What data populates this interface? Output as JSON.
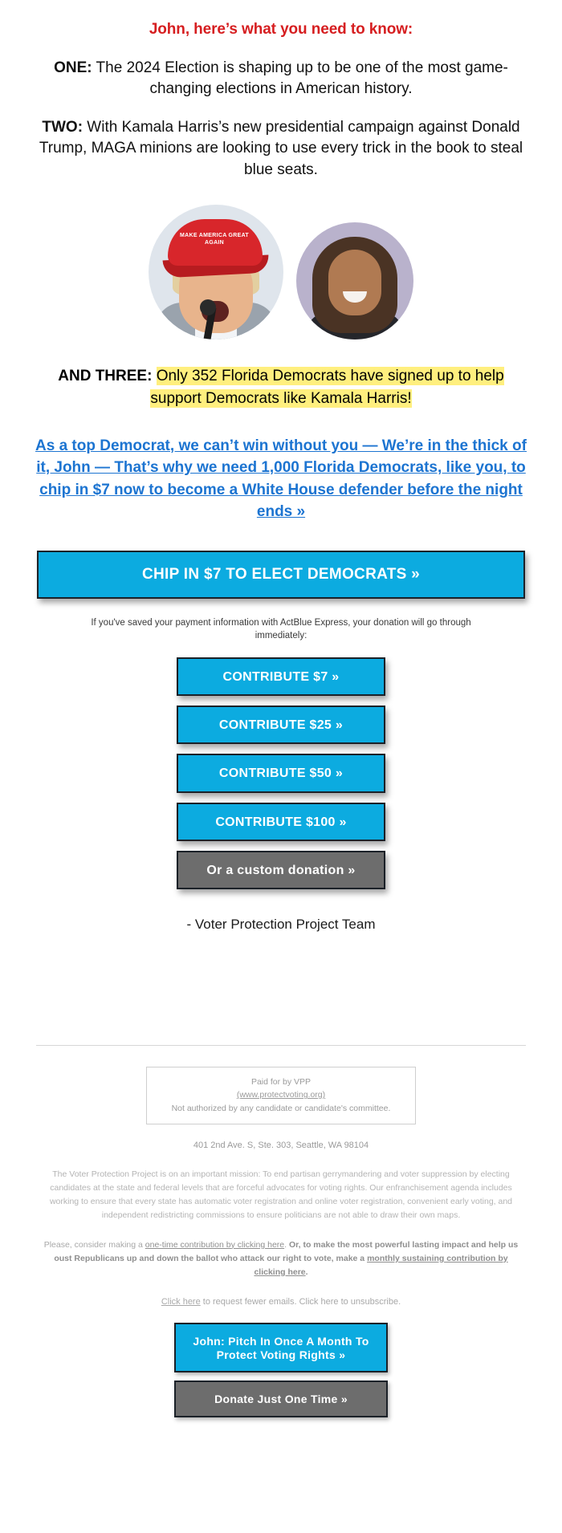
{
  "headline": "John, here’s what you need to know:",
  "points": {
    "one_label": "ONE:",
    "one_text": " The 2024 Election is shaping up to be one of the most game-changing elections in American history.",
    "two_label": "TWO:",
    "two_text": " With Kamala Harris’s new presidential campaign against Donald Trump, MAGA minions are looking to use every trick in the book to steal blue seats.",
    "three_label": "AND THREE:",
    "three_highlight": "Only 352 Florida Democrats have signed up to help support Democrats like Kamala Harris!"
  },
  "images": {
    "trump_alt": "Donald Trump wearing a red Make America Great Again cap, speaking at a microphone",
    "trump_cap_text": "MAKE AMERICA GREAT AGAIN",
    "harris_alt": "Kamala Harris smiling portrait"
  },
  "blue_link": "As a top Democrat, we can’t win without you — We’re in the thick of it, John — That’s why we need 1,000 Florida Democrats, like you, to chip in $7 now to become a White House defender before the night ends »",
  "cta": {
    "main_button": "CHIP IN $7 TO ELECT DEMOCRATS »",
    "actblue_note": "If you've saved your payment information with ActBlue Express, your donation will go through immediately:"
  },
  "amounts": [
    {
      "label": "CONTRIBUTE $7 »",
      "style": "blue"
    },
    {
      "label": "CONTRIBUTE $25 »",
      "style": "blue"
    },
    {
      "label": "CONTRIBUTE $50 »",
      "style": "blue"
    },
    {
      "label": "CONTRIBUTE $100 »",
      "style": "blue"
    },
    {
      "label": "Or a custom donation »",
      "style": "gray"
    }
  ],
  "signoff": "- Voter Protection Project Team",
  "footer": {
    "paid_for_line1": "Paid for by VPP",
    "paid_for_url": "(www.protectvoting.org)",
    "paid_for_line3": "Not authorized by any candidate or candidate's committee.",
    "address": "401 2nd Ave. S, Ste. 303, Seattle, WA 98104",
    "mission": "The Voter Protection Project is on an important mission: To end partisan gerrymandering and voter suppression by electing candidates at the state and federal levels that are forceful advocates for voting rights. Our enfranchisement agenda includes working to ensure that every state has automatic voter registration and online voter registration, convenient early voting, and independent redistricting commissions to ensure politicians are not able to draw their own maps.",
    "ask_prefix": "Please, consider making a ",
    "ask_link1": "one-time contribution by clicking here",
    "ask_mid": ". ",
    "ask_bold": "Or, to make the most powerful lasting impact and help us oust Republicans up and down the ballot who attack our right to vote, make a ",
    "ask_link2": "monthly sustaining contribution by clicking here",
    "ask_suffix": ".",
    "unsub_link": "Click here",
    "unsub_text": " to request fewer emails. Click here to unsubscribe.",
    "monthly_button": "John: Pitch In Once A Month To Protect Voting Rights »",
    "onetime_button": "Donate Just One Time »"
  },
  "colors": {
    "headline_red": "#d61e20",
    "cta_blue": "#0cabe0",
    "gray_button": "#6d6d6d",
    "link_blue": "#1c74d1",
    "highlight_yellow": "#ffef7e"
  }
}
